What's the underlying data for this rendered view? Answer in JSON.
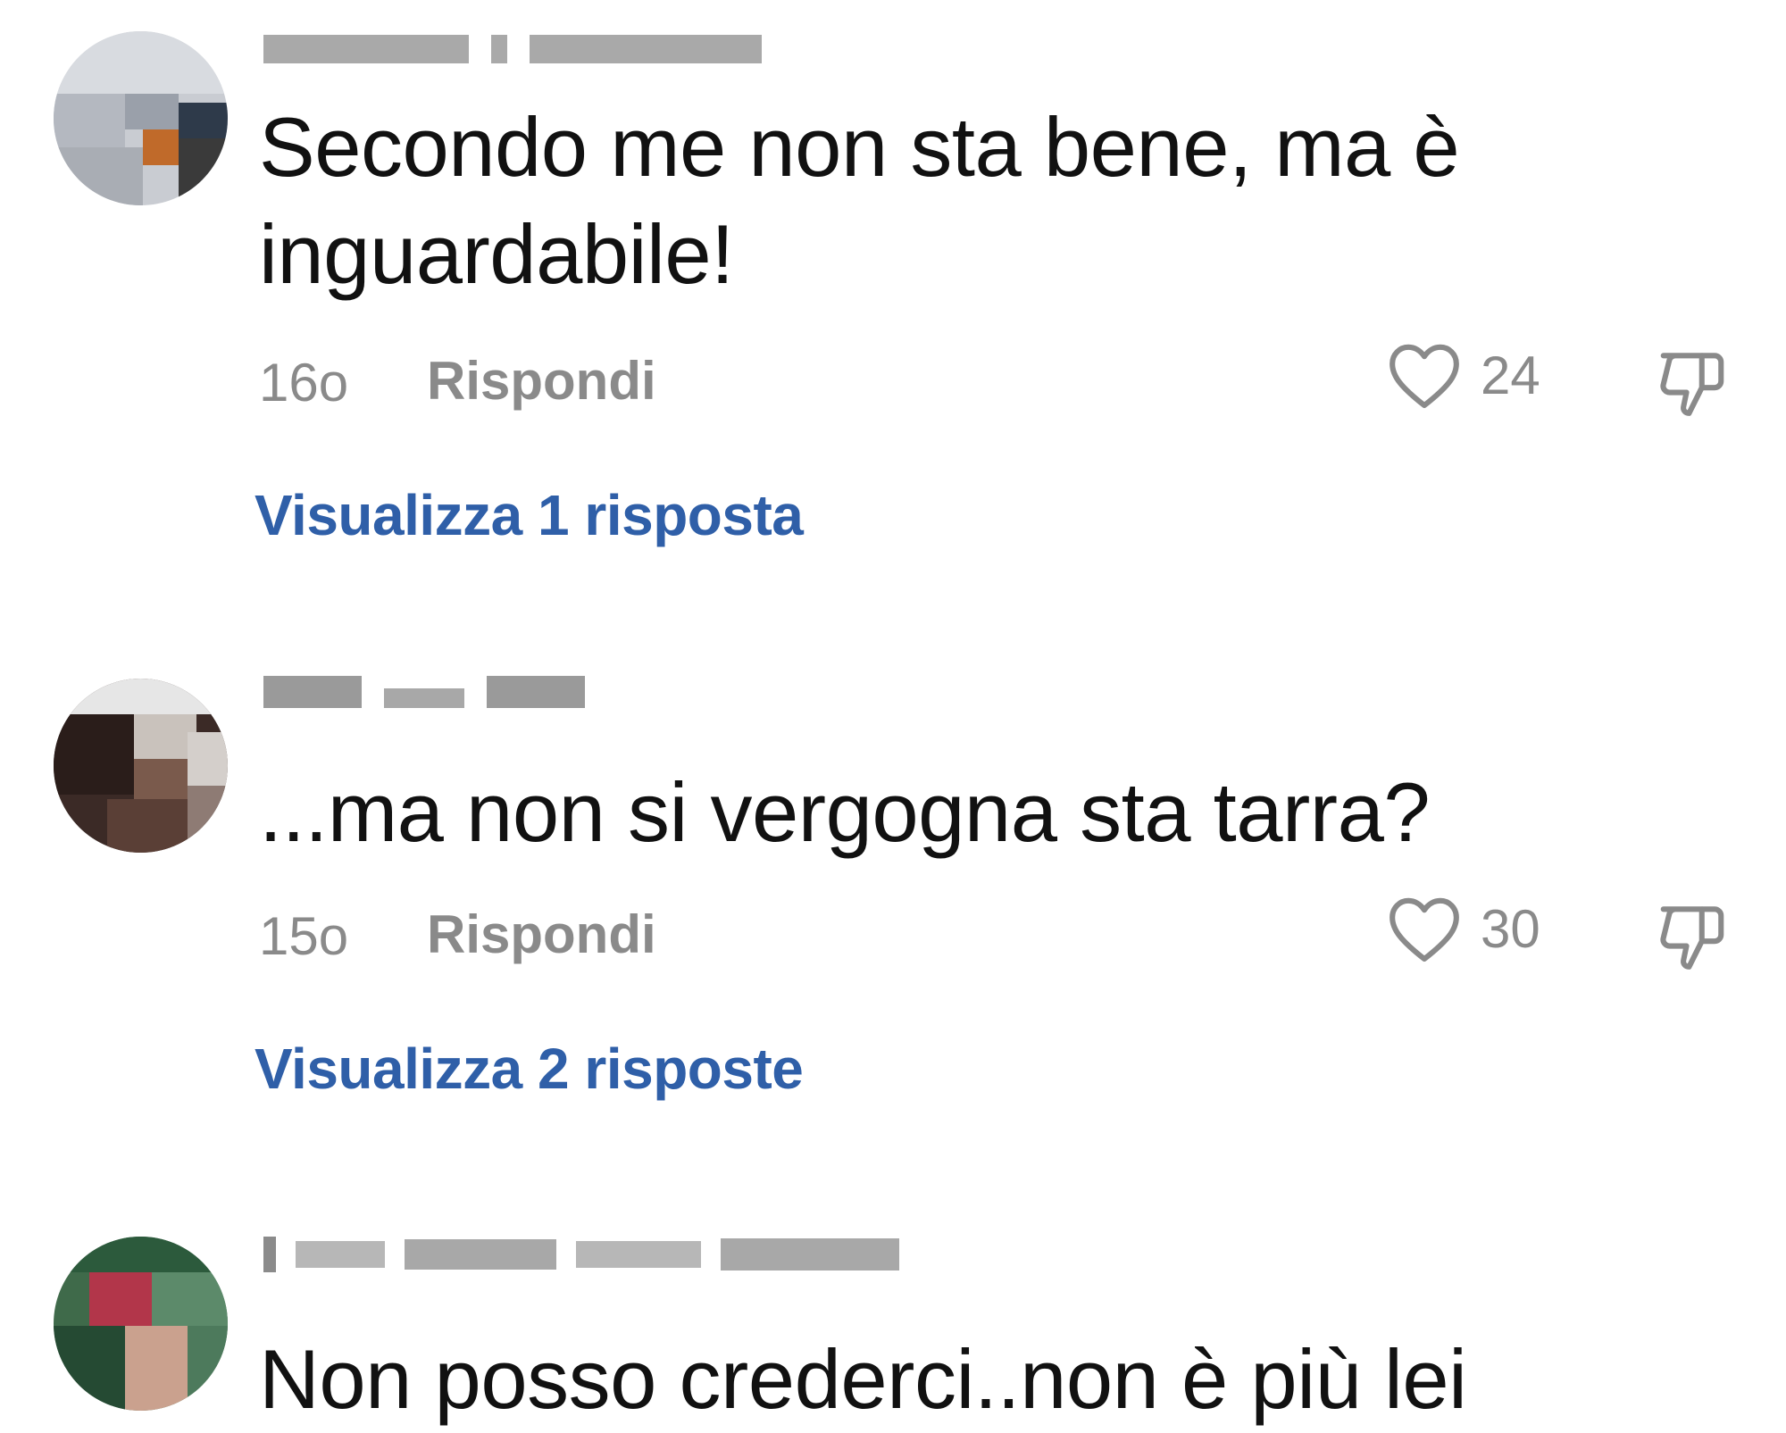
{
  "comments": [
    {
      "text": "Secondo me non sta bene, ma è inguardabile!",
      "time": "16o",
      "reply_label": "Rispondi",
      "likes": "24",
      "view_replies_label": "Visualizza 1 risposta"
    },
    {
      "text": "...ma non si vergogna sta tarra?",
      "time": "15o",
      "reply_label": "Rispondi",
      "likes": "30",
      "view_replies_label": "Visualizza 2 risposte"
    },
    {
      "text": "Non posso crederci..non è più lei"
    }
  ],
  "icons": {
    "like": "heart-outline-icon",
    "dislike": "thumbs-down-outline-icon"
  },
  "colors": {
    "text": "#111111",
    "meta": "#8a8a8a",
    "link": "#2f5fa8",
    "background": "#ffffff"
  }
}
